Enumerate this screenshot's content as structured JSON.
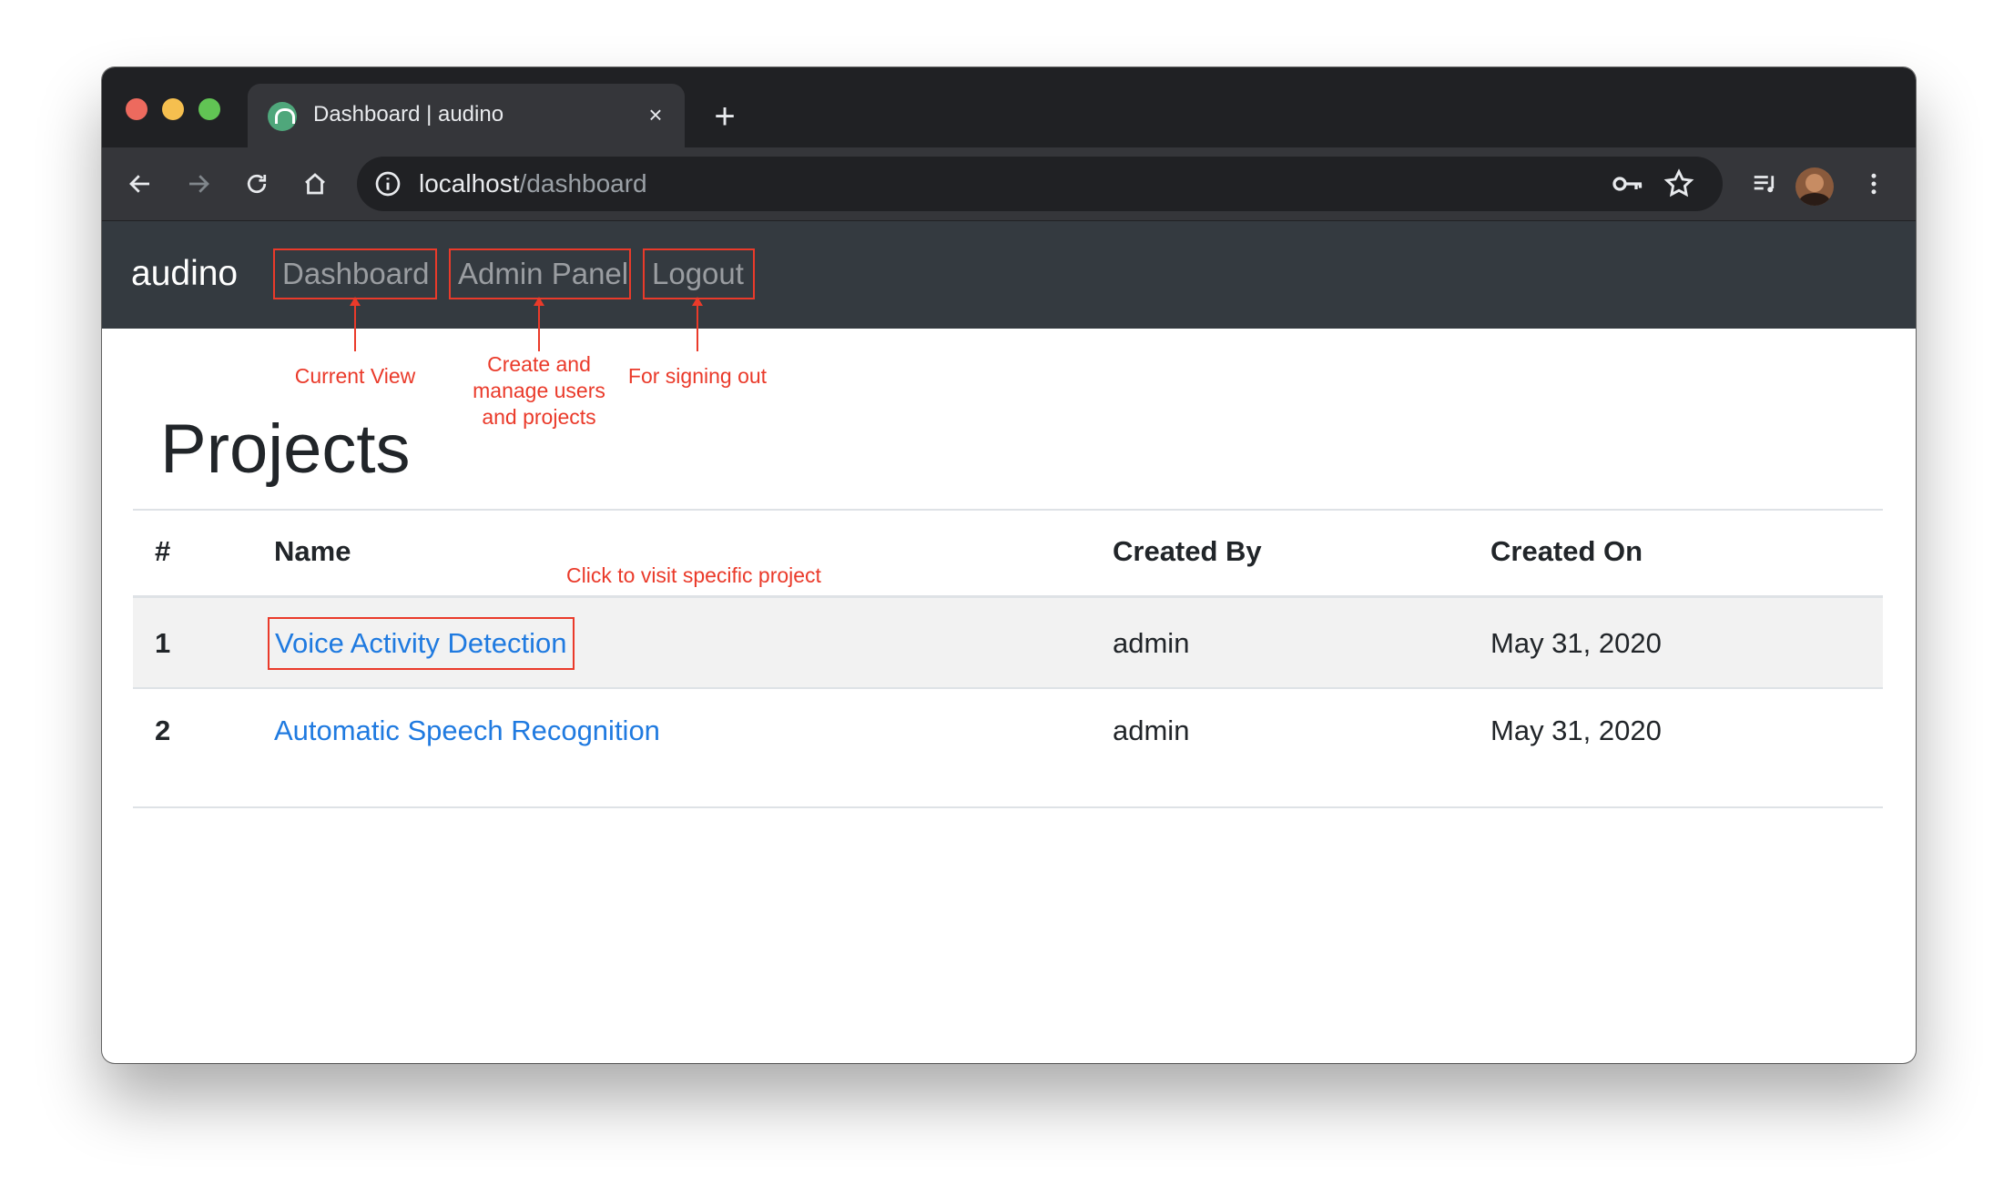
{
  "browser": {
    "tab_title": "Dashboard | audino",
    "tab_close": "×",
    "new_tab": "+",
    "url_host": "localhost",
    "url_path": "/dashboard"
  },
  "navbar": {
    "brand": "audino",
    "links": [
      {
        "label": "Dashboard"
      },
      {
        "label": "Admin Panel"
      },
      {
        "label": "Logout"
      }
    ]
  },
  "annotations": {
    "dashboard_note": "Current View",
    "admin_note_line1": "Create and",
    "admin_note_line2": "manage users",
    "admin_note_line3": "and projects",
    "logout_note": "For signing out",
    "project_note": "Click to visit specific project"
  },
  "page": {
    "title": "Projects",
    "table": {
      "headers": [
        "#",
        "Name",
        "Created By",
        "Created On"
      ],
      "rows": [
        {
          "num": "1",
          "name": "Voice Activity Detection",
          "created_by": "admin",
          "created_on": "May 31, 2020"
        },
        {
          "num": "2",
          "name": "Automatic Speech Recognition",
          "created_by": "admin",
          "created_on": "May 31, 2020"
        }
      ]
    }
  },
  "colors": {
    "annotation": "#ea3a2a",
    "link": "#1f7ae0",
    "navbar_bg": "#343a40",
    "browser_dark": "#202124"
  }
}
